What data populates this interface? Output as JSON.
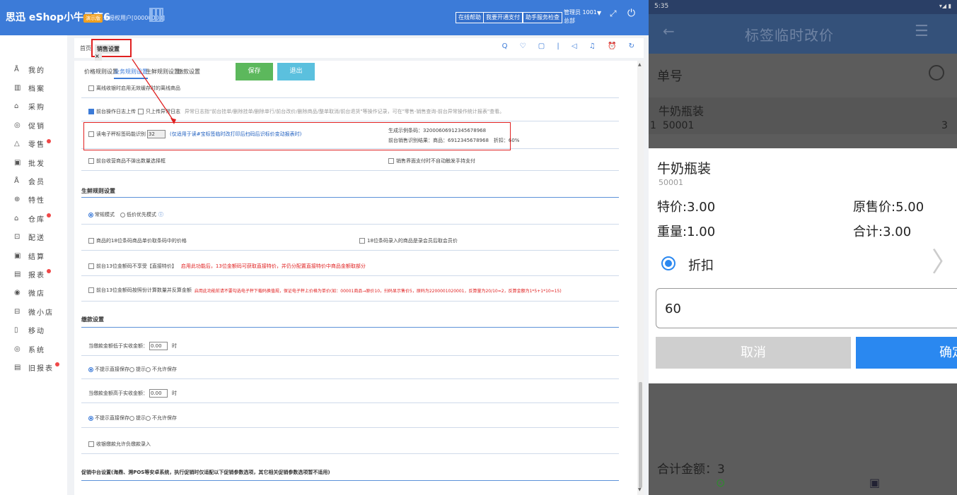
{
  "app": {
    "brand": "思迅 eShop小牛云商6",
    "badge": "演示版",
    "unauth": "未授权用户[00000000]",
    "top_buttons": [
      "在线帮助",
      "我要开通支付",
      "助手服务检查"
    ],
    "admin": "管理员 1001",
    "branch": "总部"
  },
  "sidebar": {
    "items": [
      {
        "icon": "user-icon",
        "glyph": "Å",
        "label": "我的",
        "dot": false
      },
      {
        "icon": "archive-icon",
        "glyph": "▥",
        "label": "档案",
        "dot": false
      },
      {
        "icon": "purchase-icon",
        "glyph": "⌂",
        "label": "采购",
        "dot": false
      },
      {
        "icon": "promo-icon",
        "glyph": "◎",
        "label": "促销",
        "dot": false
      },
      {
        "icon": "retail-icon",
        "glyph": "△",
        "label": "零售",
        "dot": true
      },
      {
        "icon": "wholesale-icon",
        "glyph": "▣",
        "label": "批发",
        "dot": false
      },
      {
        "icon": "member-icon",
        "glyph": "Å",
        "label": "会员",
        "dot": false
      },
      {
        "icon": "feature-icon",
        "glyph": "⊕",
        "label": "特性",
        "dot": false
      },
      {
        "icon": "warehouse-icon",
        "glyph": "⌂",
        "label": "仓库",
        "dot": true
      },
      {
        "icon": "delivery-icon",
        "glyph": "⊡",
        "label": "配送",
        "dot": false
      },
      {
        "icon": "settlement-icon",
        "glyph": "▣",
        "label": "结算",
        "dot": false
      },
      {
        "icon": "report-icon",
        "glyph": "▤",
        "label": "报表",
        "dot": true
      },
      {
        "icon": "store-icon",
        "glyph": "◉",
        "label": "微店",
        "dot": false
      },
      {
        "icon": "mini-store-icon",
        "glyph": "⊟",
        "label": "微小店",
        "dot": false
      },
      {
        "icon": "mobile-icon",
        "glyph": "▯",
        "label": "移动",
        "dot": false
      },
      {
        "icon": "system-icon",
        "glyph": "◎",
        "label": "系统",
        "dot": false
      },
      {
        "icon": "old-report-icon",
        "glyph": "▤",
        "label": "旧报表",
        "dot": true
      }
    ]
  },
  "tabs": {
    "home": "首页",
    "active": "销售设置",
    "close": "×"
  },
  "toolbar_icons": "Q ♡ ▢ | ◁ ♫ ⏰ ↻",
  "subtabs": [
    "价格规则设置",
    "业务规则设置",
    "生鲜规则设置",
    "缴款设置"
  ],
  "buttons": {
    "save": "保存",
    "exit": "退出"
  },
  "settings": {
    "r1": "离线收银时启用无效缓存时的离线商品",
    "r2a": "前台操作日志上传",
    "r2b": "只上传异常日志",
    "r2c": "异常日志指\"前台挂单/删除挂单/删除单行/前台改价/删除商品/整单取消/前台退货\"等操作记录，可在\"零售-销售查询-前台异常操作统计报表\"查看。",
    "r3a": "读电子秤标签码能识别",
    "r3val": "32",
    "r3b": "(仅适用于读#宝标签临时改打印后扫码后识标价变动报表时)",
    "r3c1": "生成示例条码：32000606912345678968",
    "r3c2": "前台销售识别结果：商品：6912345678968　折扣：60%",
    "r4a": "前台收营商品不弹出数量选择框",
    "r4b": "销售界面支付时不自动触发手持支付",
    "fresh_title": "生鲜规则设置",
    "mode_normal": "常规模式",
    "mode_price": "低价优先模式",
    "r5a": "商品的18位条码商品单价取条码中的价格",
    "r5b": "18位条码录入的商品是录会员后取会员价",
    "r6a": "前台13位金额码不享受【直接特价】",
    "r6b": "启用此功能后，13位金额码可获取直接特价，并仍分配置直接特价中商品金额取部分",
    "r7a": "前台13位金额码按照份计算数量并反算金额",
    "r7b": "启用此功能前请不要勾选电子秤下载码换值规，保证电子秤上价格为单价(如：00001商品→原价10，扫码显示售价5，原码为2200001020001，反算量为20/10=2，反算金额为1*5+1*10=15)",
    "pay_title": "缴款设置",
    "p1a": "当缴款金额低于实收金额：",
    "p1val": "0.00",
    "p1b": "时",
    "p2a": "不提示直接保存",
    "p2b": "提示",
    "p2c": "不允许保存",
    "p3a": "当缴款金额高于实收金额：",
    "p3val": "0.00",
    "p3b": "时",
    "p4a": "不提示直接保存",
    "p4b": "提示",
    "p4c": "不允许保存",
    "p5": "收银缴款允许负缴款录入",
    "promo_title": "促销中台设置(海鼎、溯POS等安卓系统，执行促销时仅适配以下促销参数选项，其它相关促销参数选项暂不适用)"
  },
  "phone": {
    "time": "5:35",
    "status_icons": "▾◢ ▮",
    "title": "标签临时改价",
    "order_label": "单号",
    "list_item": {
      "name": "牛奶瓶装",
      "index": "1",
      "code": "50001",
      "qty": "3"
    },
    "dialog": {
      "name": "牛奶瓶装",
      "code": "50001",
      "special_price": "特价:3.00",
      "original_price": "原售价:5.00",
      "weight": "重量:1.00",
      "total": "合计:3.00",
      "discount_label": "折扣",
      "input_value": "60",
      "cancel": "取消",
      "ok": "确定"
    },
    "total_label": "合计金额：3"
  }
}
